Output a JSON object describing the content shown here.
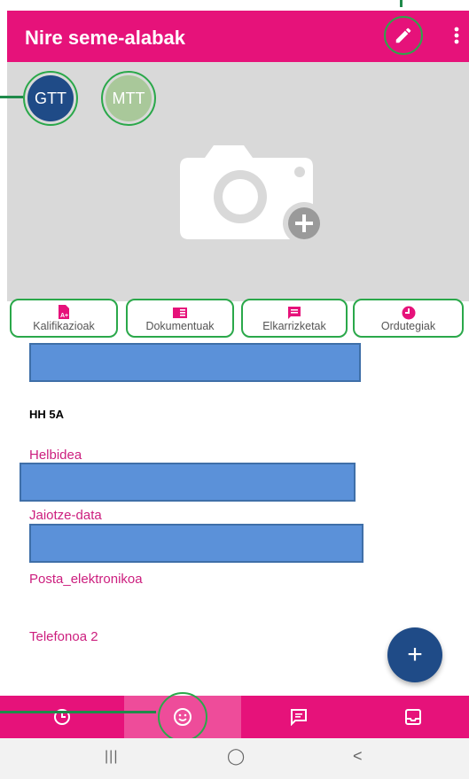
{
  "appbar": {
    "title": "Nire seme-alabak",
    "edit_icon": "pencil-icon",
    "more_icon": "more-vertical-icon",
    "color": "#e6127a"
  },
  "children": [
    {
      "initials": "GTT",
      "color": "#1f4b87",
      "selected": true
    },
    {
      "initials": "MTT",
      "color": "#a9c89a",
      "selected": false
    }
  ],
  "photo": {
    "icon": "camera-add-icon"
  },
  "tabs": [
    {
      "label": "Kalifikazioak",
      "icon": "grades-icon"
    },
    {
      "label": "Dokumentuak",
      "icon": "documents-icon"
    },
    {
      "label": "Elkarrizketak",
      "icon": "chat-icon"
    },
    {
      "label": "Ordutegiak",
      "icon": "clock-icon"
    }
  ],
  "profile": {
    "group": "HH 5A",
    "fields": [
      {
        "label": "Helbidea"
      },
      {
        "label": "Jaiotze-data"
      },
      {
        "label": "Posta_elektronikoa"
      },
      {
        "label": "Telefonoa 2"
      }
    ]
  },
  "fab": {
    "symbol": "+",
    "color": "#1f4b87"
  },
  "bottom_nav": [
    {
      "icon": "history-icon",
      "active": false
    },
    {
      "icon": "smile-icon",
      "active": true
    },
    {
      "icon": "message-icon",
      "active": false
    },
    {
      "icon": "inbox-icon",
      "active": false
    }
  ],
  "system_nav": {
    "recents": "|||",
    "home": "◯",
    "back": "<"
  }
}
